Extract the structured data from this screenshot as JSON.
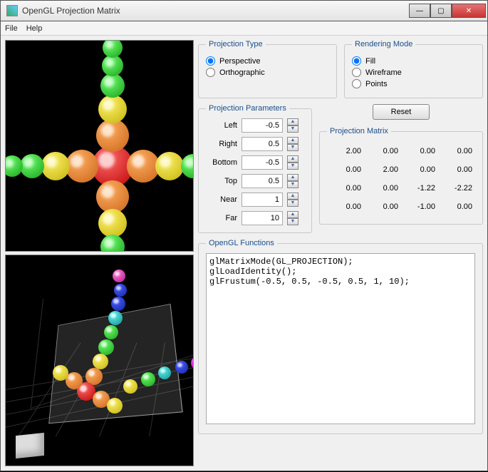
{
  "window": {
    "title": "OpenGL Projection Matrix"
  },
  "menu": {
    "file": "File",
    "help": "Help"
  },
  "projType": {
    "legend": "Projection Type",
    "perspective": "Perspective",
    "orthographic": "Orthographic",
    "selected": "perspective"
  },
  "renderMode": {
    "legend": "Rendering Mode",
    "fill": "Fill",
    "wireframe": "Wireframe",
    "points": "Points",
    "selected": "fill"
  },
  "params": {
    "legend": "Projection Parameters",
    "left": {
      "label": "Left",
      "value": "-0.5"
    },
    "right": {
      "label": "Right",
      "value": "0.5"
    },
    "bottom": {
      "label": "Bottom",
      "value": "-0.5"
    },
    "top": {
      "label": "Top",
      "value": "0.5"
    },
    "near": {
      "label": "Near",
      "value": "1"
    },
    "far": {
      "label": "Far",
      "value": "10"
    }
  },
  "reset": "Reset",
  "matrix": {
    "legend": "Projection Matrix",
    "m": [
      "2.00",
      "0.00",
      "0.00",
      "0.00",
      "0.00",
      "2.00",
      "0.00",
      "0.00",
      "0.00",
      "0.00",
      "-1.22",
      "-2.22",
      "0.00",
      "0.00",
      "-1.00",
      "0.00"
    ]
  },
  "funcs": {
    "legend": "OpenGL Functions",
    "code": "glMatrixMode(GL_PROJECTION);\nglLoadIdentity();\nglFrustum(-0.5, 0.5, -0.5, 0.5, 1, 10);"
  },
  "colors": {
    "red": "#d11",
    "orange": "#e67e22",
    "yellow": "#e6d40f",
    "green": "#2ecc40",
    "blue": "#1040c0",
    "cyan": "#20d0d0",
    "magenta": "#d030d0",
    "purple": "#8030c0"
  }
}
